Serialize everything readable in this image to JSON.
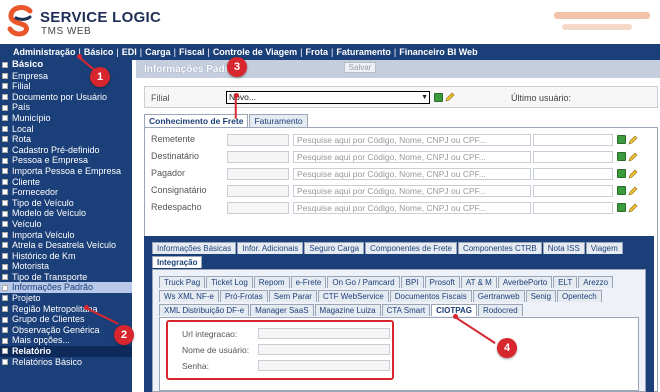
{
  "header": {
    "brand_title": "SERVICE LOGIC",
    "brand_subtitle": "TMS WEB"
  },
  "menu": [
    {
      "label": "Administração"
    },
    {
      "label": "Básico"
    },
    {
      "label": "EDI"
    },
    {
      "label": "Carga"
    },
    {
      "label": "Fiscal"
    },
    {
      "label": "Controle de Viagem"
    },
    {
      "label": "Frota"
    },
    {
      "label": "Faturamento"
    },
    {
      "label": "Financeiro BI Web"
    }
  ],
  "sidebar": {
    "section_basico": "Básico",
    "items": [
      "Empresa",
      "Filial",
      "Documento por Usuário",
      "País",
      "Município",
      "Local",
      "Rota",
      "Cadastro Pré-definido",
      "Pessoa e Empresa",
      "Importa Pessoa e Empresa",
      "Cliente",
      "Fornecedor",
      "Tipo de Veículo",
      "Modelo de Veículo",
      "Veículo",
      "Importa Veículo",
      "Atrela e Desatrela Veículo",
      "Histórico de Km",
      "Motorista",
      "Tipo de Transporte",
      "Informações Padrão",
      "Projeto",
      "Região Metropolitana",
      "Grupo de Clientes",
      "Observação Genérica",
      "Mais opções..."
    ],
    "section_relatorio": "Relatório",
    "relatorios_basico": "Relatórios Básico"
  },
  "panel": {
    "title": "Informações Padrão",
    "save_label": "Salvar",
    "filial_label": "Filial",
    "filial_value": "Novo...",
    "ultimo_usuario_label": "Último usuário:"
  },
  "cf_tabs": [
    "Conhecimento de Frete",
    "Faturamento"
  ],
  "parties": {
    "placeholder": "Pesquise aqui por Código, Nome, CNPJ ou CPF...",
    "labels": [
      "Remetente",
      "Destinatário",
      "Pagador",
      "Consignatário",
      "Redespacho"
    ]
  },
  "tabs_row1": [
    "Informações Básicas",
    "Infor. Adicionais",
    "Seguro Carga",
    "Componentes de Frete",
    "Componentes CTRB",
    "Nota ISS",
    "Viagem"
  ],
  "tabs_row2": [
    "Integração"
  ],
  "tabs_row3": [
    "Truck Pag",
    "Ticket Log",
    "Repom",
    "e-Frete",
    "On Go / Pamcard",
    "BPI",
    "Prosoft",
    "AT & M",
    "AverbePorto",
    "ELT",
    "Arezzo"
  ],
  "tabs_row4": [
    "Ws XML NF-e",
    "Pró-Frotas",
    "Sem Parar",
    "CTF WebService",
    "Documentos Fiscais",
    "Gertranweb",
    "Senig",
    "Opentech"
  ],
  "tabs_row5": [
    "XML Distribuição DF-e",
    "Manager SaaS",
    "Magazine Luiza",
    "CTA Smart",
    "CIOTPAG",
    "Rodocred"
  ],
  "ciotpag": {
    "url_label": "Url integracao:",
    "user_label": "Nome de usuário:",
    "pass_label": "Senha:"
  },
  "callouts": [
    "1",
    "2",
    "3",
    "4"
  ],
  "colors": {
    "nav_bg": "#1b3f78",
    "callout_red": "#d8262e",
    "logo_orange": "#e8562a",
    "logo_navy": "#1d2f56"
  }
}
